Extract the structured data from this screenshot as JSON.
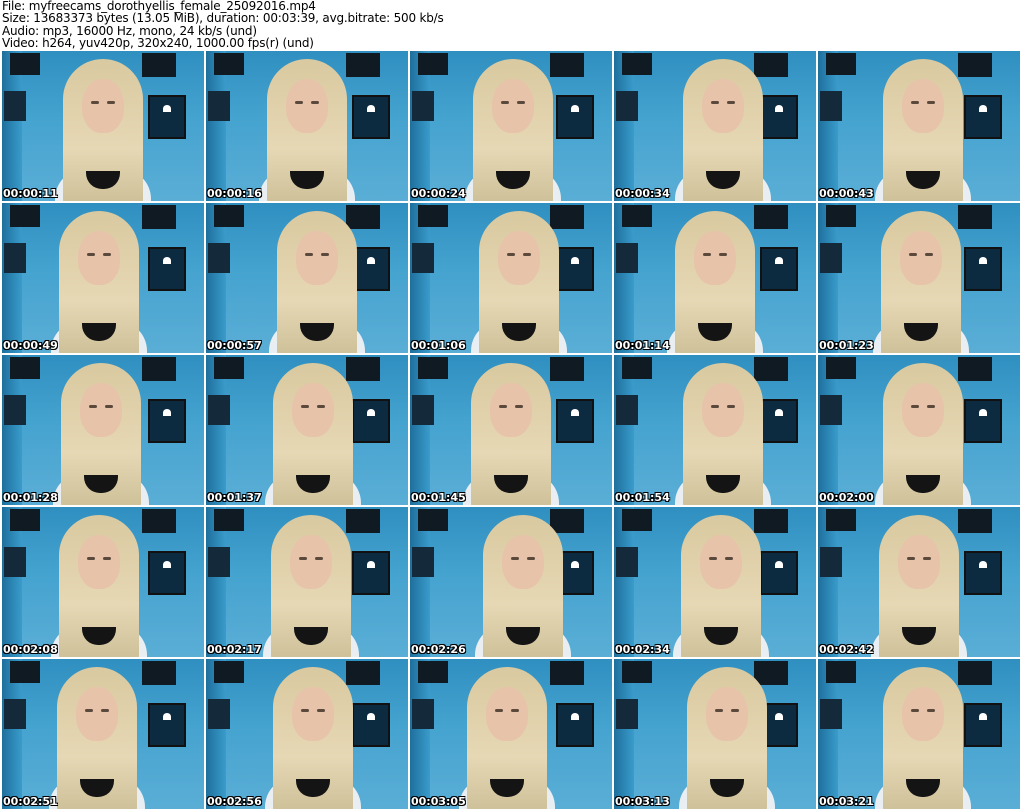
{
  "header": {
    "file": "File: myfreecams_dorothyellis_female_25092016.mp4",
    "size": "Size: 13683373 bytes (13.05 MiB), duration: 00:03:39, avg.bitrate: 500 kb/s",
    "audio": "Audio: mp3, 16000 Hz, mono, 24 kb/s (und)",
    "video": "Video: h264, yuv420p, 320x240, 1000.00 fps(r) (und)"
  },
  "thumbnails": [
    {
      "time": "00:00:11",
      "offset": 0
    },
    {
      "time": "00:00:16",
      "offset": 0
    },
    {
      "time": "00:00:24",
      "offset": 2
    },
    {
      "time": "00:00:34",
      "offset": 8
    },
    {
      "time": "00:00:43",
      "offset": 4
    },
    {
      "time": "00:00:49",
      "offset": -4
    },
    {
      "time": "00:00:57",
      "offset": 10
    },
    {
      "time": "00:01:06",
      "offset": 8
    },
    {
      "time": "00:01:14",
      "offset": 0
    },
    {
      "time": "00:01:23",
      "offset": 2
    },
    {
      "time": "00:01:28",
      "offset": -2
    },
    {
      "time": "00:01:37",
      "offset": 6
    },
    {
      "time": "00:01:45",
      "offset": 0
    },
    {
      "time": "00:01:54",
      "offset": 8
    },
    {
      "time": "00:02:00",
      "offset": 4
    },
    {
      "time": "00:02:08",
      "offset": -4
    },
    {
      "time": "00:02:17",
      "offset": 4
    },
    {
      "time": "00:02:26",
      "offset": 12
    },
    {
      "time": "00:02:34",
      "offset": 6
    },
    {
      "time": "00:02:42",
      "offset": 0
    },
    {
      "time": "00:02:51",
      "offset": -6
    },
    {
      "time": "00:02:56",
      "offset": 6
    },
    {
      "time": "00:03:05",
      "offset": -4
    },
    {
      "time": "00:03:13",
      "offset": 12
    },
    {
      "time": "00:03:21",
      "offset": 4
    }
  ]
}
